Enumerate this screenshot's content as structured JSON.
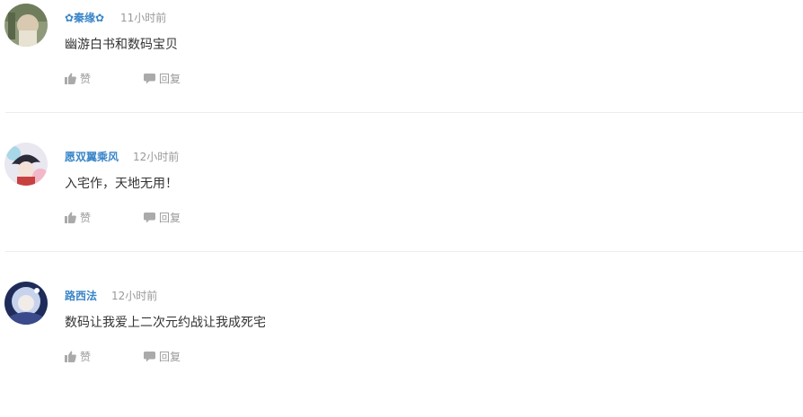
{
  "comments": [
    {
      "username": "✿秦缘✿",
      "time": "11小时前",
      "text": "幽游白书和数码宝贝",
      "like_label": "赞",
      "reply_label": "回复"
    },
    {
      "username": "愿双翼乘风",
      "time": "12小时前",
      "text": "入宅作，天地无用！",
      "like_label": "赞",
      "reply_label": "回复"
    },
    {
      "username": "路西法",
      "time": "12小时前",
      "text": "数码让我爱上二次元约战让我成死宅",
      "like_label": "赞",
      "reply_label": "回复"
    }
  ],
  "colors": {
    "username": "#3a86c8",
    "meta": "#999999",
    "text": "#333333",
    "divider": "#ececec"
  },
  "icons": {
    "like": "thumbs-up-icon",
    "reply": "speech-bubble-icon"
  }
}
